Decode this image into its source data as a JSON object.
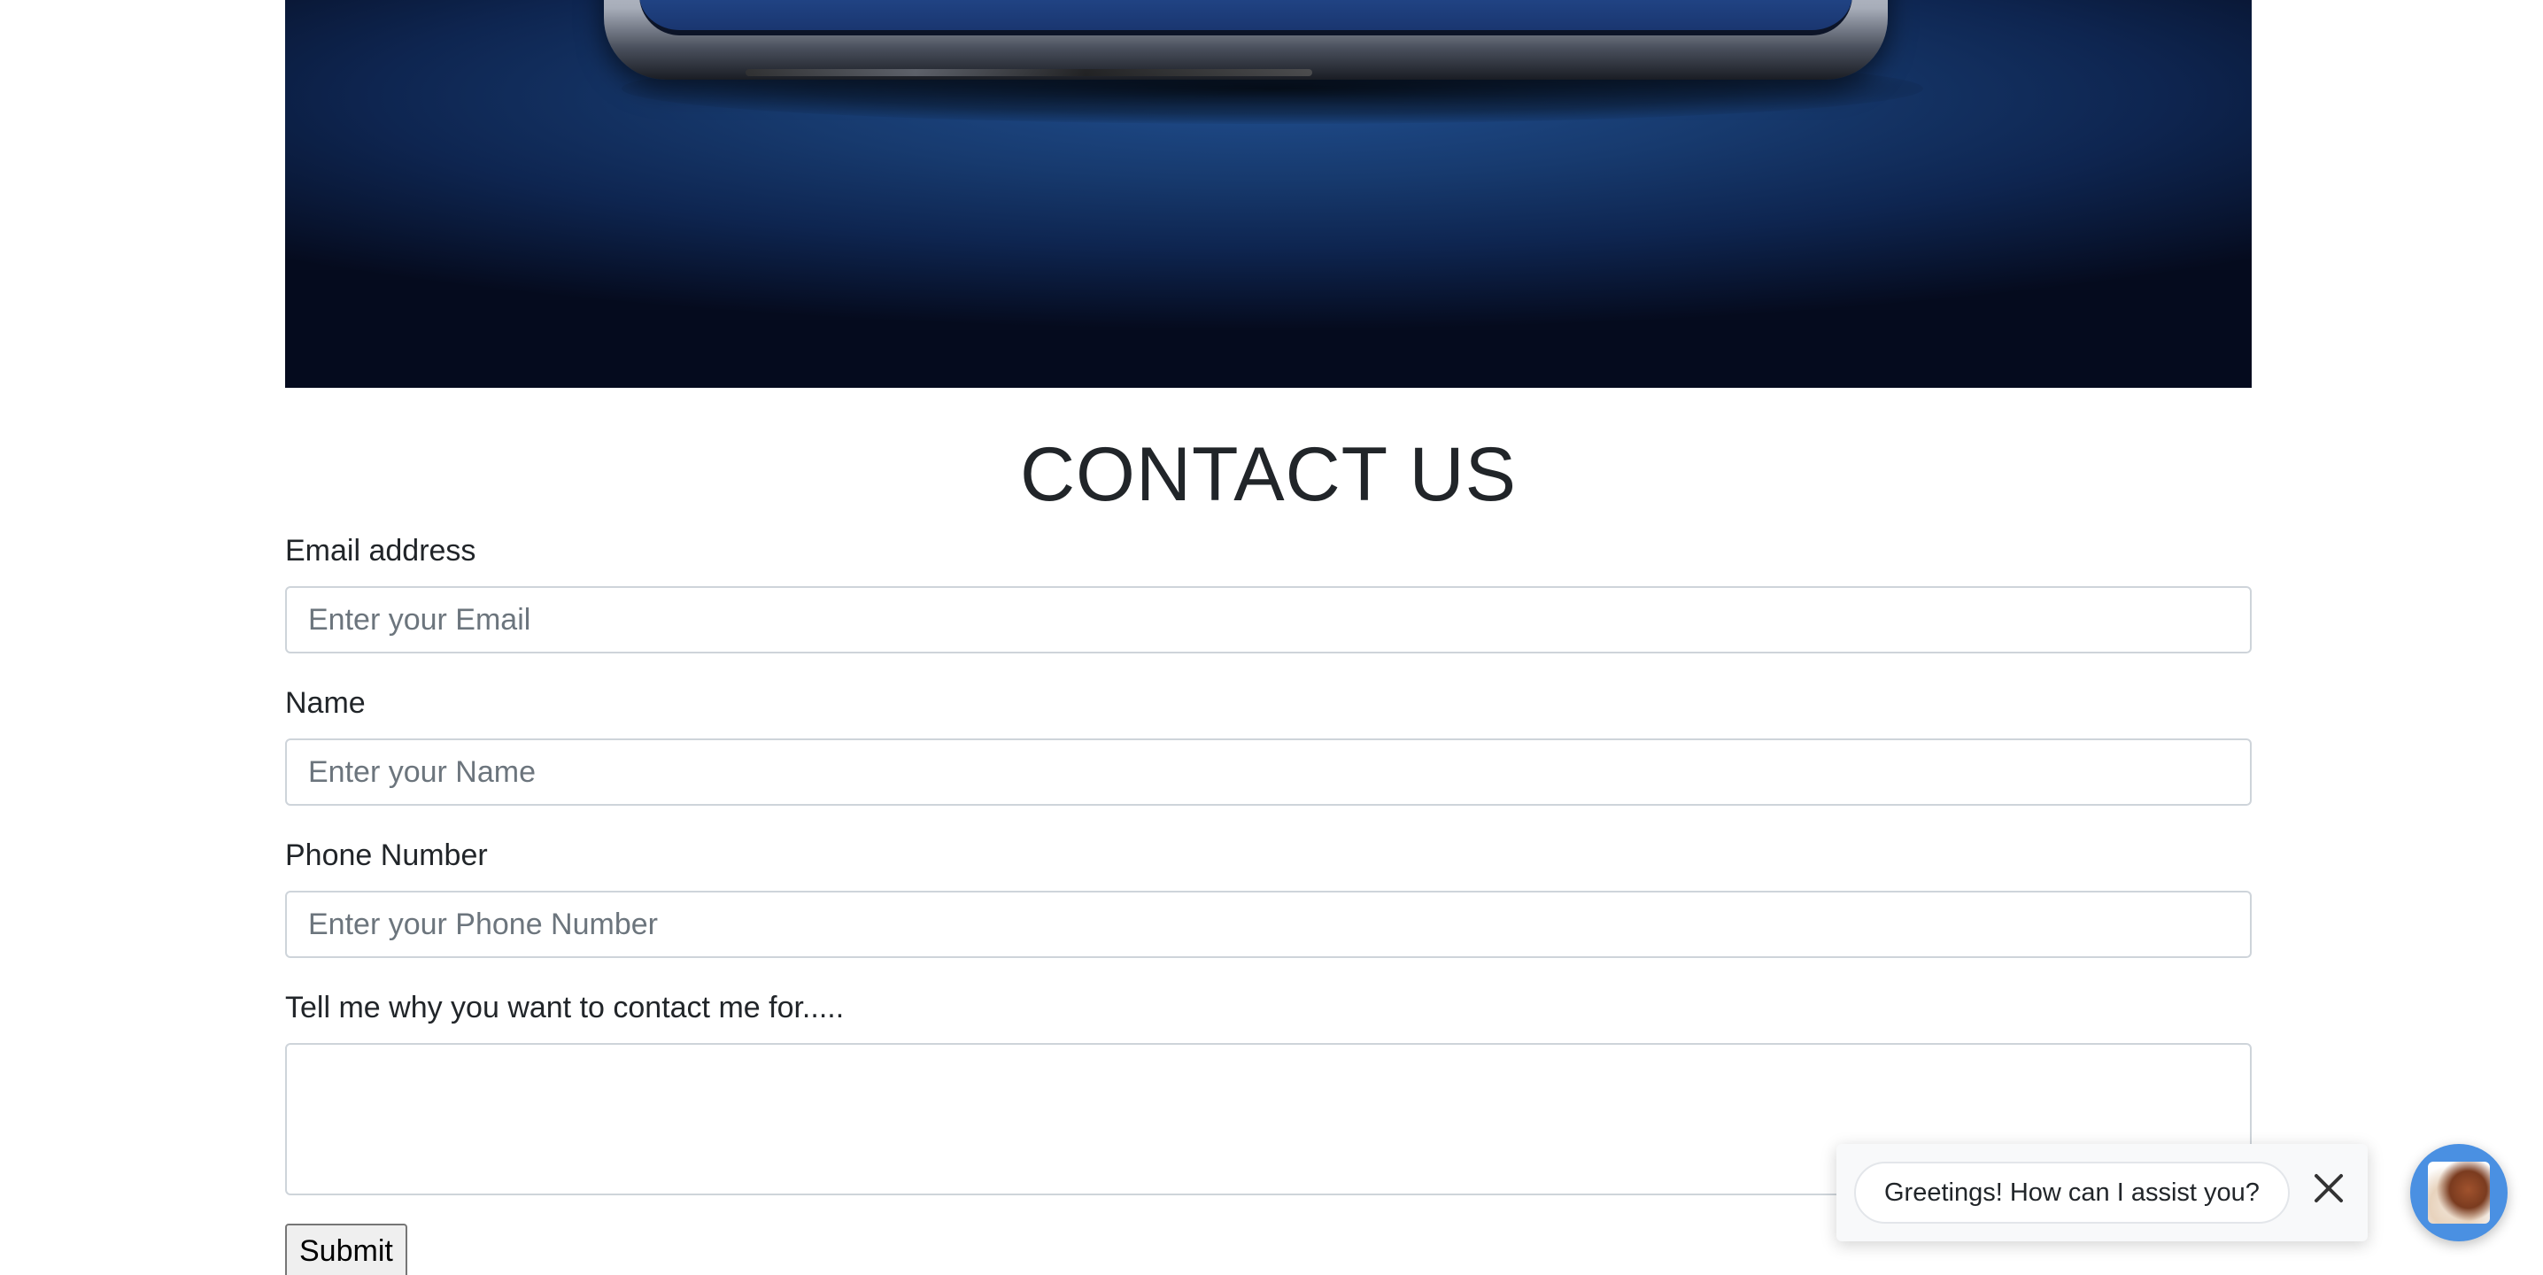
{
  "hero": {
    "image_alt": "phone on blue backdrop"
  },
  "page": {
    "title": "CONTACT US"
  },
  "form": {
    "email": {
      "label": "Email address",
      "placeholder": "Enter your Email",
      "value": ""
    },
    "name": {
      "label": "Name",
      "placeholder": "Enter your Name",
      "value": ""
    },
    "phone": {
      "label": "Phone Number",
      "placeholder": "Enter your Phone Number",
      "value": ""
    },
    "message": {
      "label": "Tell me why you want to contact me for.....",
      "value": ""
    },
    "submit_label": "Submit"
  },
  "chat": {
    "greeting": "Greetings! How can I assist you?",
    "close_icon": "close-icon",
    "launcher_icon": "avatar-image",
    "launcher_color": "#4a90e2"
  },
  "colors": {
    "text": "#212529",
    "input_border": "#ced4da",
    "placeholder": "#6c757d"
  }
}
